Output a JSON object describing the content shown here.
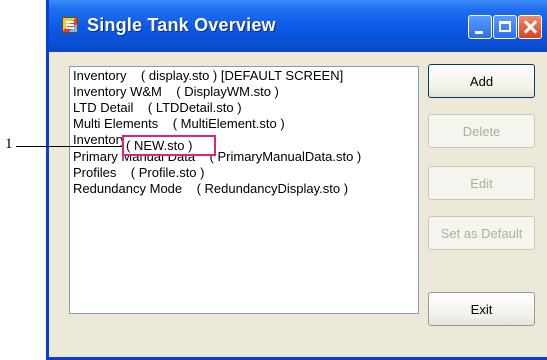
{
  "window": {
    "title": "Single Tank Overview",
    "icon": "tank-app-icon",
    "controls": [
      "minimize-icon",
      "maximize-icon",
      "close-icon"
    ]
  },
  "list": {
    "items": [
      "Inventory    ( display.sto ) [DEFAULT SCREEN]",
      "Inventory W&M    ( DisplayWM.sto )",
      "LTD Detail    ( LTDDetail.sto )",
      "Multi Elements    ( MultiElement.sto )",
      "Inventory",
      "Primary Manual Data    ( PrimaryManualData.sto )",
      "Profiles    ( Profile.sto )",
      "Redundancy Mode    ( RedundancyDisplay.sto )"
    ]
  },
  "buttons": {
    "add": "Add",
    "delete": "Delete",
    "edit": "Edit",
    "set_default": "Set as Default",
    "exit": "Exit"
  },
  "callout": {
    "number": "1",
    "highlight_text": "( NEW.sto )",
    "color": "#e0217f"
  }
}
